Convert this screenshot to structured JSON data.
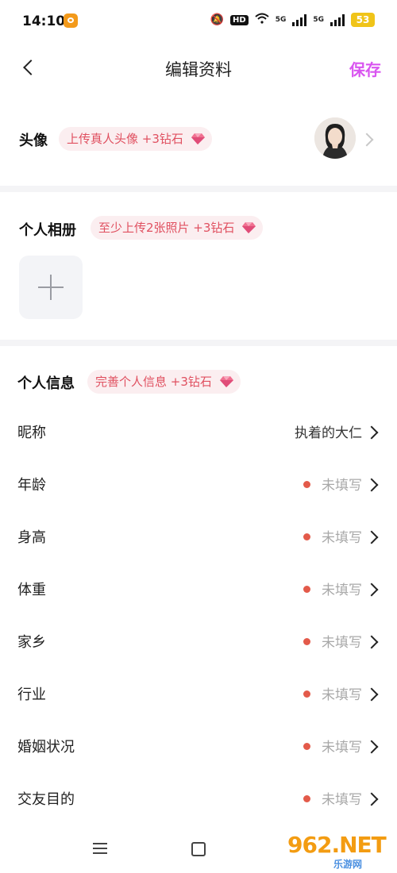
{
  "status_bar": {
    "time": "14:10",
    "hd": "HD",
    "sig1": "5G",
    "sig2": "5G",
    "battery": "53"
  },
  "header": {
    "title": "编辑资料",
    "save_label": "保存"
  },
  "avatar_section": {
    "label": "头像",
    "badge": "上传真人头像 +3钻石"
  },
  "album_section": {
    "label": "个人相册",
    "badge": "至少上传2张照片 +3钻石"
  },
  "info_section": {
    "label": "个人信息",
    "badge": "完善个人信息 +3钻石",
    "rows": [
      {
        "label": "昵称",
        "value": "执着的大仁"
      },
      {
        "label": "年龄",
        "value": "未填写"
      },
      {
        "label": "身高",
        "value": "未填写"
      },
      {
        "label": "体重",
        "value": "未填写"
      },
      {
        "label": "家乡",
        "value": "未填写"
      },
      {
        "label": "行业",
        "value": "未填写"
      },
      {
        "label": "婚姻状况",
        "value": "未填写"
      },
      {
        "label": "交友目的",
        "value": "未填写"
      }
    ]
  },
  "watermark": {
    "main": "962.NET",
    "sub": "乐游网"
  },
  "colors": {
    "accent": "#d955f0",
    "badge_text": "#e05060",
    "badge_bg": "#fbeef0",
    "dot": "#e35a4a"
  }
}
